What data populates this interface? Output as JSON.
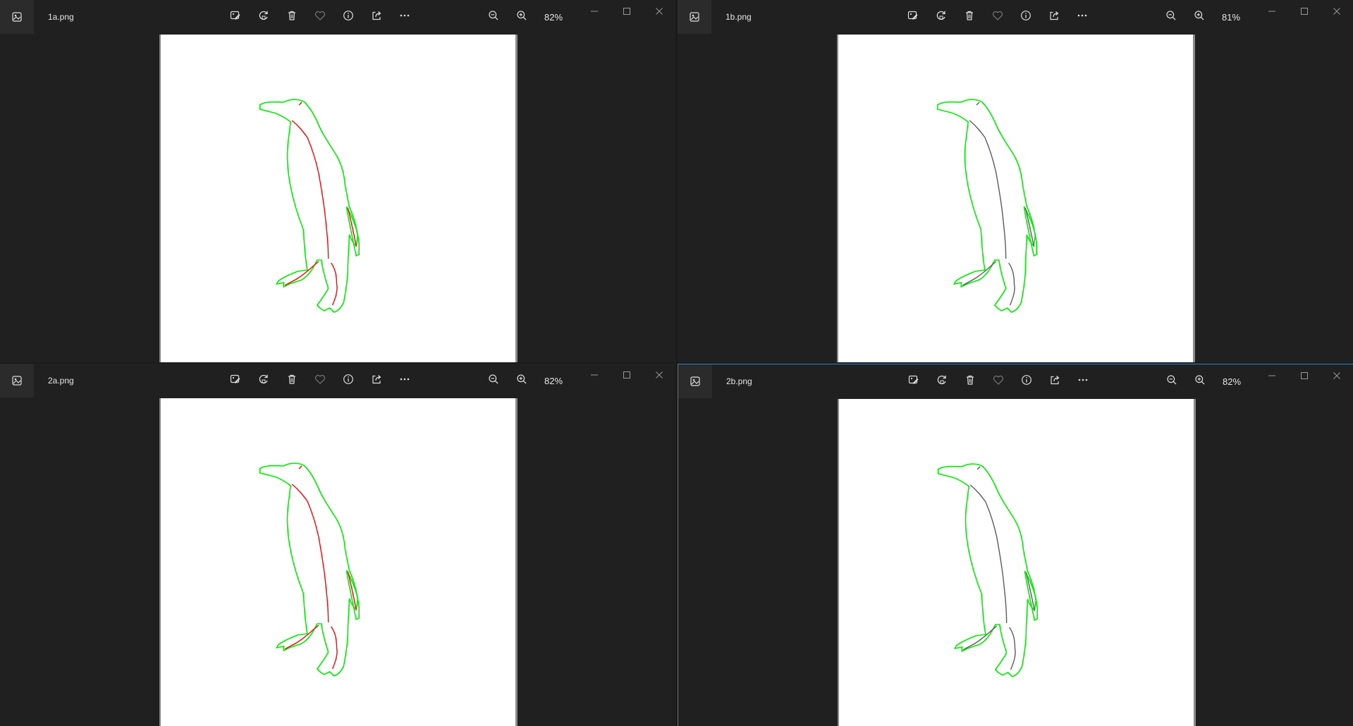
{
  "windows": [
    {
      "filename": "1a.png",
      "zoom": "82%",
      "interior_color": "#ff0000",
      "active": false
    },
    {
      "filename": "1b.png",
      "zoom": "81%",
      "interior_color": "#5a5a5a",
      "active": false
    },
    {
      "filename": "2a.png",
      "zoom": "82%",
      "interior_color": "#ff0000",
      "active": false
    },
    {
      "filename": "2b.png",
      "zoom": "82%",
      "interior_color": "#5a5a5a",
      "active": true
    }
  ],
  "toolbar_icons": [
    "edit-image-icon",
    "rotate-icon",
    "delete-icon",
    "favorite-icon",
    "info-icon",
    "share-icon",
    "more-icon"
  ],
  "zoom_icons": [
    "zoom-out-icon",
    "zoom-in-icon"
  ],
  "window_controls": [
    "minimize-icon",
    "maximize-icon",
    "close-icon"
  ],
  "colors": {
    "outline": "#00ee00",
    "accent_border": "#2f7fcf",
    "background": "#202020"
  }
}
